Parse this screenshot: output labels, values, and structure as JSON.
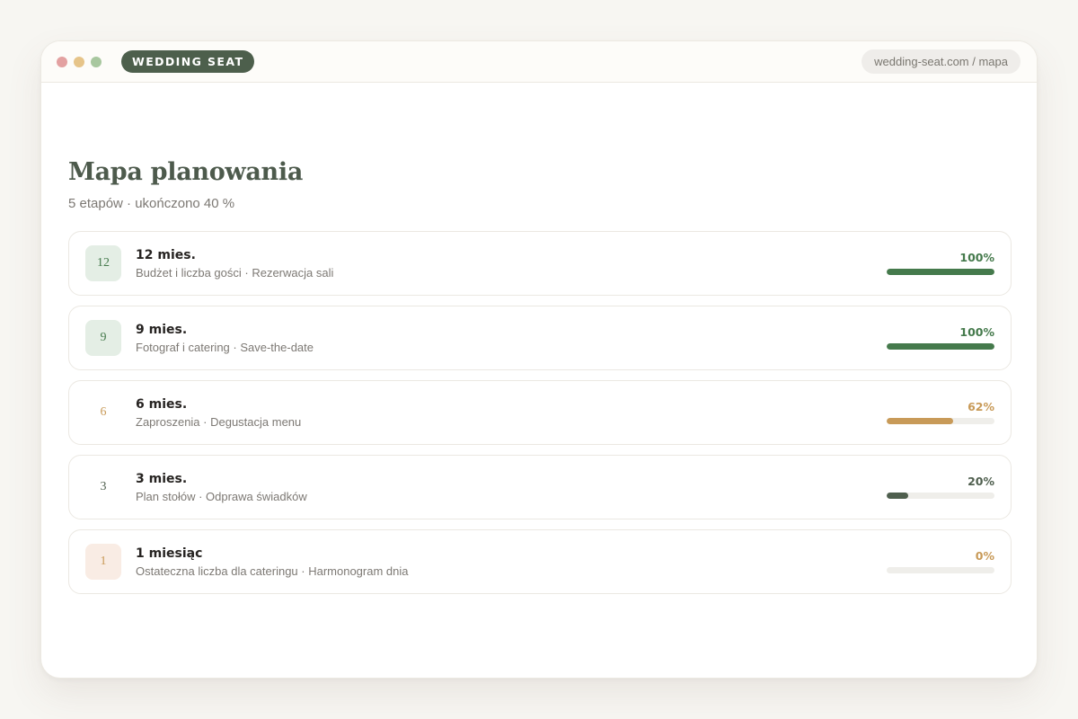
{
  "window": {
    "dots": [
      {
        "color": "#e3a1a1"
      },
      {
        "color": "#e6c489"
      },
      {
        "color": "#a8c79f"
      }
    ],
    "brand_label": "WEDDING SEAT",
    "brand_color": "#4d5f4c",
    "url": "wedding-seat.com / mapa"
  },
  "page": {
    "title": "Mapa planowania",
    "subtitle": "5 etapów · ukończono 40 %"
  },
  "stages": [
    {
      "badge": "12",
      "title": "12 mies.",
      "tasks": "Budżet i liczba gości · Rezerwacja sali",
      "percent_label": "100%",
      "progress": 1.0,
      "color": "#457a4c",
      "badge_bg": "#e4eee5",
      "badge_color": "#457a4c"
    },
    {
      "badge": "9",
      "title": "9 mies.",
      "tasks": "Fotograf i catering · Save-the-date",
      "percent_label": "100%",
      "progress": 1.0,
      "color": "#457a4c",
      "badge_bg": "#e4eee5",
      "badge_color": "#457a4c"
    },
    {
      "badge": "6",
      "title": "6 mies.",
      "tasks": "Zaproszenia · Degustacja menu",
      "percent_label": "62%",
      "progress": 0.62,
      "color": "#c89a58",
      "badge_bg": "#ffffff",
      "badge_color": "#c89a58"
    },
    {
      "badge": "3",
      "title": "3 mies.",
      "tasks": "Plan stołów · Odprawa świadków",
      "percent_label": "20%",
      "progress": 0.2,
      "color": "#4f5f4e",
      "badge_bg": "#ffffff",
      "badge_color": "#4f5f4e"
    },
    {
      "badge": "1",
      "title": "1 miesiąc",
      "tasks": "Ostateczna liczba dla cateringu · Harmonogram dnia",
      "percent_label": "0%",
      "progress": 0.0,
      "color": "#c89a58",
      "badge_bg": "#f9ece4",
      "badge_color": "#c89a58"
    }
  ]
}
